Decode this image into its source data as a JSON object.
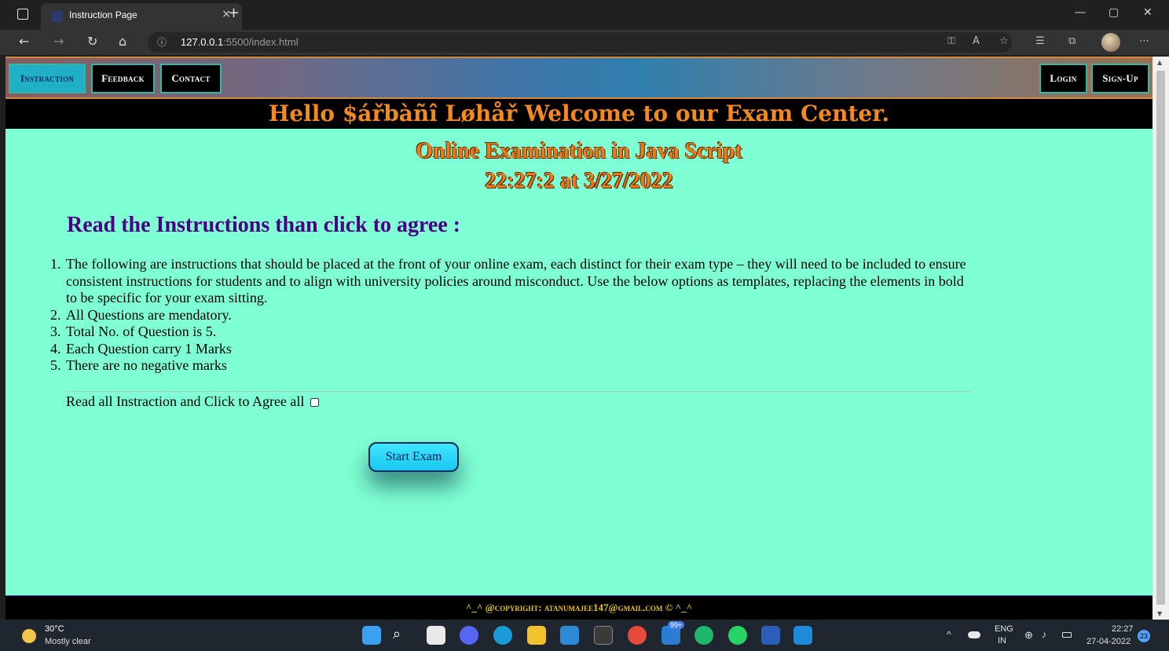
{
  "browser": {
    "tab_title": "Instruction Page",
    "tab_close": "×",
    "new_tab": "+",
    "url_host": "127.0.0.1",
    "url_rest": ":5500/index.html",
    "window_controls": [
      "—",
      "▢",
      "✕"
    ]
  },
  "nav": {
    "left": [
      "Instraction",
      "Feedback",
      "Contact"
    ],
    "right": [
      "Login",
      "Sign-Up"
    ],
    "active": "Instraction"
  },
  "welcome": "Hello $ářbàñî Løhåř Welcome to our Exam Center.",
  "title": "Online Examination in Java Script",
  "clock": "22:27:2 at 3/27/2022",
  "instructions_heading": "Read the Instructions than click to agree :",
  "instructions": [
    "The following are instructions that should be placed at the front of your online exam, each distinct for their exam type – they will need to be included to ensure consistent instructions for students and to align with university policies around misconduct. Use the below options as templates, replacing the elements in bold to be specific for your exam sitting.",
    "All Questions are mendatory.",
    "Total No. of Question is 5.",
    "Each Question carry 1 Marks",
    "There are no negative marks"
  ],
  "agree_label": "Read all Instraction and Click to Agree all",
  "start_button": "Start Exam",
  "footer": "^_^ @copyright: atanumajee147@gmail.com © ^_^",
  "taskbar": {
    "temp": "30°C",
    "weather": "Mostly clear",
    "lang_top": "ENG",
    "lang_bottom": "IN",
    "time": "22:27",
    "date": "27-04-2022",
    "notifications": "23",
    "store_badge": "99+"
  },
  "colors": {
    "page_bg": "#7fffd4",
    "welcome_text": "#f48a1e",
    "heading": "#4b0082",
    "footer_text": "#e7c21a"
  }
}
